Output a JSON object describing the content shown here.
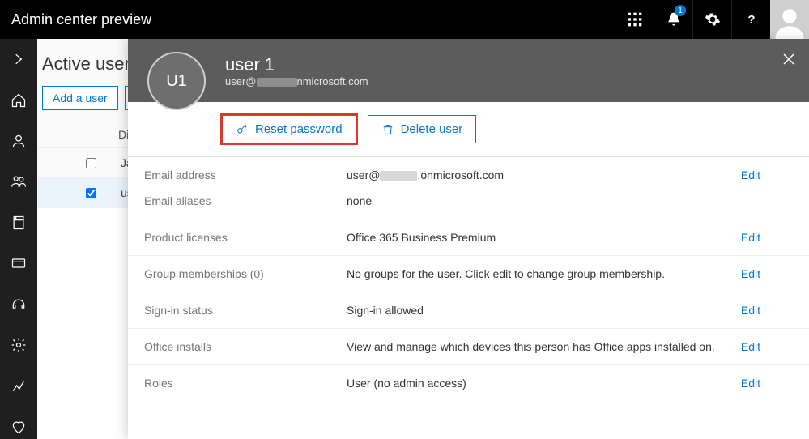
{
  "topbar": {
    "title": "Admin center preview",
    "notifications_count": "1"
  },
  "page": {
    "title": "Active users",
    "toolbar": {
      "add_user": "Add a user"
    },
    "grid": {
      "header_display_name": "Disp",
      "rows": [
        {
          "name": "Jag",
          "selected": false
        },
        {
          "name": "use",
          "selected": true
        }
      ]
    }
  },
  "flyout": {
    "initials": "U1",
    "name": "user 1",
    "email_prefix": "user@",
    "email_suffix_header": "nmicrosoft.com",
    "actions": {
      "reset_password": "Reset password",
      "delete_user": "Delete user"
    },
    "details": [
      {
        "label": "Email address",
        "value_prefix": "user@",
        "value_suffix": ".onmicrosoft.com",
        "masked": true,
        "edit": "Edit"
      },
      {
        "label": "Email aliases",
        "value": "none",
        "edit": ""
      },
      {
        "label": "Product licenses",
        "value": "Office 365 Business Premium",
        "edit": "Edit"
      },
      {
        "label": "Group memberships (0)",
        "value": "No groups for the user. Click edit to change group membership.",
        "edit": "Edit"
      },
      {
        "label": "Sign-in status",
        "value": "Sign-in allowed",
        "edit": "Edit"
      },
      {
        "label": "Office installs",
        "value": "View and manage which devices this person has Office apps installed on.",
        "edit": "Edit"
      },
      {
        "label": "Roles",
        "value": "User (no admin access)",
        "edit": "Edit"
      }
    ]
  }
}
